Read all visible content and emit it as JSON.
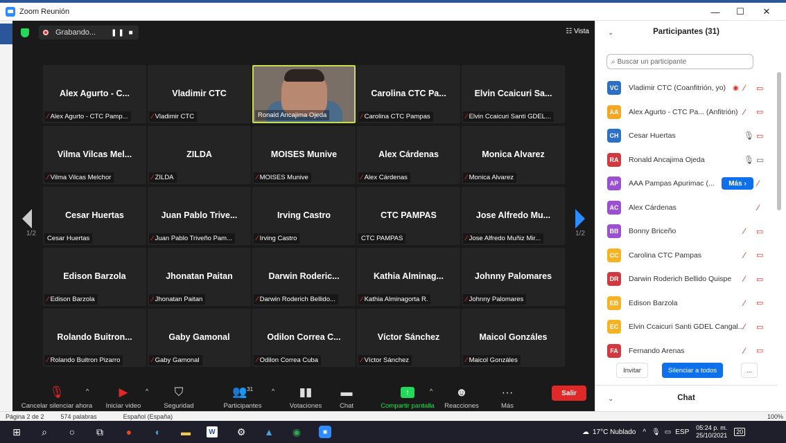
{
  "window": {
    "title": "Zoom Reunión",
    "min": "—",
    "max": "☐",
    "close": "✕"
  },
  "topbar": {
    "recording_label": "Grabando...",
    "rec_controls": "❚❚ ■",
    "view_label": "☷ Vista"
  },
  "grid": {
    "page_left": "1/2",
    "page_right": "1/2",
    "tiles": [
      {
        "name": "Alex Agurto - C...",
        "label": "Alex Agurto - CTC Pamp...",
        "muted": true
      },
      {
        "name": "Vladimir CTC",
        "label": "Vladimir CTC",
        "muted": true
      },
      {
        "name": "",
        "label": "Ronald Ancajima Ojeda",
        "muted": false,
        "video": true
      },
      {
        "name": "Carolina CTC Pa...",
        "label": "Carolina CTC Pampas",
        "muted": true
      },
      {
        "name": "Elvin Ccaicuri Sa...",
        "label": "Elvin Ccaicuri Santi GDEL...",
        "muted": true
      },
      {
        "name": "Vilma Vilcas Mel...",
        "label": "Vilma Vilcas Melchor",
        "muted": true
      },
      {
        "name": "ZILDA",
        "label": "ZILDA",
        "muted": true
      },
      {
        "name": "MOISES Munive",
        "label": "MOISES Munive",
        "muted": true
      },
      {
        "name": "Alex Cárdenas",
        "label": "Alex Cárdenas",
        "muted": true
      },
      {
        "name": "Monica Alvarez",
        "label": "Monica Alvarez",
        "muted": true
      },
      {
        "name": "Cesar Huertas",
        "label": "Cesar Huertas",
        "muted": false
      },
      {
        "name": "Juan Pablo Trive...",
        "label": "Juan Pablo Triveño Pam...",
        "muted": true
      },
      {
        "name": "Irving Castro",
        "label": "Irving Castro",
        "muted": true
      },
      {
        "name": "CTC PAMPAS",
        "label": "CTC PAMPAS",
        "muted": false
      },
      {
        "name": "Jose Alfredo Mu...",
        "label": "Jose Alfredo Muñiz Mir...",
        "muted": true
      },
      {
        "name": "Edison Barzola",
        "label": "Edison Barzola",
        "muted": true
      },
      {
        "name": "Jhonatan Paitan",
        "label": "Jhonatan Paitan",
        "muted": true
      },
      {
        "name": "Darwin Roderic...",
        "label": "Darwin Roderich Bellido...",
        "muted": true
      },
      {
        "name": "Kathia Alminag...",
        "label": "Kathia Alminagorta R.",
        "muted": true
      },
      {
        "name": "Johnny Palomares",
        "label": "Johnny Palomares",
        "muted": true
      },
      {
        "name": "Rolando Buitron...",
        "label": "Rolando Buitron Pizarro",
        "muted": true
      },
      {
        "name": "Gaby Gamonal",
        "label": "Gaby Gamonal",
        "muted": true
      },
      {
        "name": "Odilon Correa C...",
        "label": "Odilon Correa Cuba",
        "muted": true
      },
      {
        "name": "Víctor Sánchez",
        "label": "Víctor Sánchez",
        "muted": true
      },
      {
        "name": "Maicol Gonzáles",
        "label": "Maicol Gonzáles",
        "muted": true
      }
    ]
  },
  "toolbar": {
    "unmute": "Cancelar silenciar ahora",
    "video": "Iniciar video",
    "security": "Seguridad",
    "participants": "Participantes",
    "participants_count": "31",
    "polls": "Votaciones",
    "chat": "Chat",
    "share": "Compartir pantalla",
    "reactions": "Reacciones",
    "more": "Más",
    "leave": "Salir"
  },
  "panel": {
    "title": "Participantes (31)",
    "search_placeholder": "Buscar un participante",
    "participants": [
      {
        "initials": "VC",
        "color": "#2d6fc4",
        "name": "Vladimir CTC (Coanfitrión, yo)"
      },
      {
        "initials": "AA",
        "color": "#f5a623",
        "name": "Alex Agurto - CTC Pa...  (Anfitrión)"
      },
      {
        "initials": "CH",
        "color": "#2d6fc4",
        "name": "Cesar Huertas"
      },
      {
        "initials": "RA",
        "color": "#d0393e",
        "name": "Ronald Ancajima Ojeda"
      },
      {
        "initials": "AP",
        "color": "#9b4fd1",
        "name": "AAA Pampas Apurimac (..."
      },
      {
        "initials": "AC",
        "color": "#9b4fd1",
        "name": "Alex Cárdenas"
      },
      {
        "initials": "BB",
        "color": "#9b4fd1",
        "name": "Bonny Briceño"
      },
      {
        "initials": "CC",
        "color": "#f5b323",
        "name": "Carolina CTC Pampas"
      },
      {
        "initials": "DR",
        "color": "#d0393e",
        "name": "Darwin Roderich Bellido Quispe"
      },
      {
        "initials": "EB",
        "color": "#f5b323",
        "name": "Edison Barzola"
      },
      {
        "initials": "EC",
        "color": "#f5b323",
        "name": "Elvin Ccaicuri Santi GDEL Cangal..."
      },
      {
        "initials": "FA",
        "color": "#d0393e",
        "name": "Fernando Arenas"
      }
    ],
    "more_button": "Más ›",
    "invite": "Invitar",
    "mute_all": "Silenciar a todos",
    "ellipsis": "...",
    "chat_title": "Chat"
  },
  "statusbar": {
    "page": "Página 2 de 2",
    "words": "574 palabras",
    "language": "Español (España)",
    "zoom": "100%"
  },
  "taskbar": {
    "weather": "17°C  Nublado",
    "lang": "ESP",
    "time": "05:24 p. m.",
    "date": "25/10/2021",
    "notif": "20"
  }
}
